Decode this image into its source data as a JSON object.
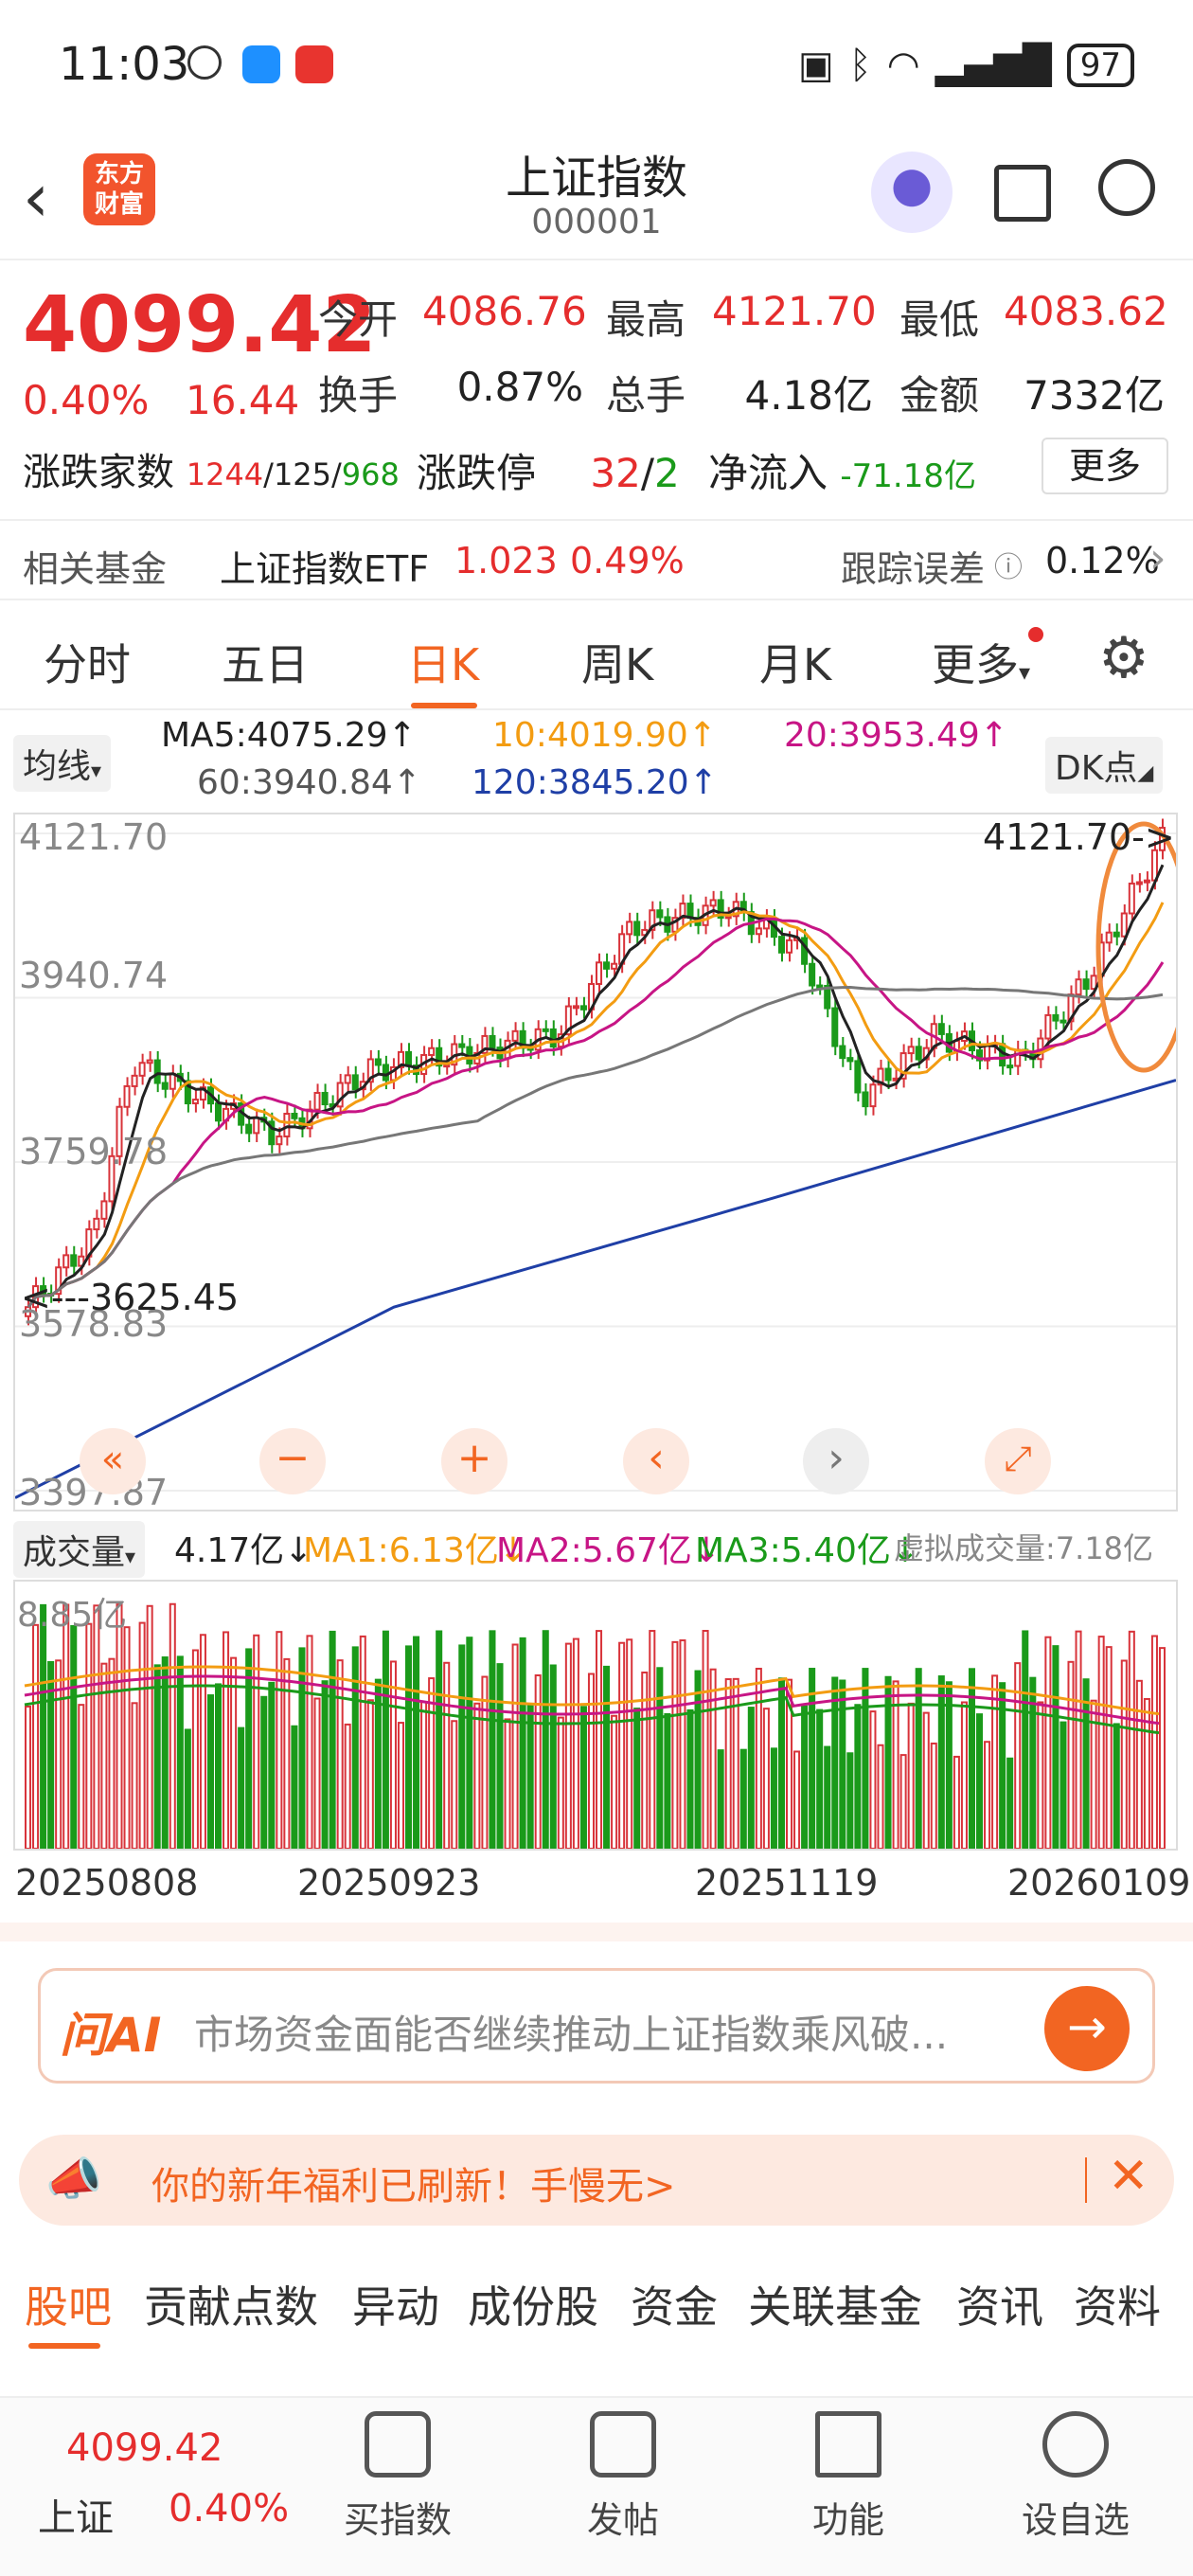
{
  "status_bar": {
    "time": "11:03",
    "battery": "97"
  },
  "header": {
    "back_icon": "chevron-left-icon",
    "logo_text": "东方财富",
    "title": "上证指数",
    "code": "000001"
  },
  "quote": {
    "price": "4099.42",
    "change_pct": "0.40%",
    "change_val": "16.44",
    "labels": {
      "open": "今开",
      "high": "最高",
      "low": "最低",
      "turnover_rate": "换手",
      "total_hands": "总手",
      "amount": "金额"
    },
    "values": {
      "open": "4086.76",
      "high": "4121.70",
      "low": "4083.62",
      "turnover_rate": "0.87%",
      "total_hands": "4.18亿",
      "amount": "7332亿"
    },
    "breadth_label": "涨跌家数",
    "breadth_up": "1244",
    "breadth_flat": "125",
    "breadth_down": "968",
    "limit_label": "涨跌停",
    "limit_up": "32",
    "limit_down": "2",
    "netflow_label": "净流入",
    "netflow": "-71.18亿",
    "more": "更多"
  },
  "fund": {
    "label": "相关基金",
    "name": "上证指数ETF",
    "price": "1.023",
    "pct": "0.49%",
    "err_label": "跟踪误差",
    "err": "0.12%"
  },
  "tabs": [
    "分时",
    "五日",
    "日K",
    "周K",
    "月K",
    "更多"
  ],
  "ma": {
    "selector": "均线",
    "ma5": "MA5:4075.29↑",
    "ma10": "10:4019.90↑",
    "ma20": "20:3953.49↑",
    "ma60": "60:3940.84↑",
    "ma120": "120:3845.20↑",
    "dk": "DK点"
  },
  "price_axis": [
    "4121.70",
    "3940.74",
    "3759.78",
    "3578.83",
    "3397.87"
  ],
  "annotations": {
    "high_marker": "4121.70->",
    "low_marker": "<---3625.45"
  },
  "volume": {
    "selector": "成交量",
    "current": "4.17亿↓",
    "ma1": "MA1:6.13亿↓",
    "ma2": "MA2:5.67亿↓",
    "ma3": "MA3:5.40亿↓",
    "virtual": "虚拟成交量:7.18亿",
    "axis_top": "8.85亿"
  },
  "dates": [
    "20250808",
    "20250923",
    "20251119",
    "20260109"
  ],
  "ai_box": {
    "logo": "问AI",
    "text": "市场资金面能否继续推动上证指数乘风破..."
  },
  "notice": {
    "text": "你的新年福利已刷新！手慢无>"
  },
  "bottom_tabs": [
    "股吧",
    "贡献点数",
    "异动",
    "成份股",
    "资金",
    "关联基金",
    "资讯",
    "资料"
  ],
  "footer": {
    "price": "4099.42",
    "name": "上证",
    "pct": "0.40%",
    "items": [
      "买指数",
      "发帖",
      "功能",
      "设自选"
    ]
  },
  "chart_data": {
    "type": "candlestick",
    "x_range": [
      "20250808",
      "20260109"
    ],
    "ylim": [
      3397.87,
      4121.7
    ],
    "price_high": 4121.7,
    "price_low_marked": 3625.45,
    "close": 4099.42,
    "volume_max": "8.85亿"
  }
}
